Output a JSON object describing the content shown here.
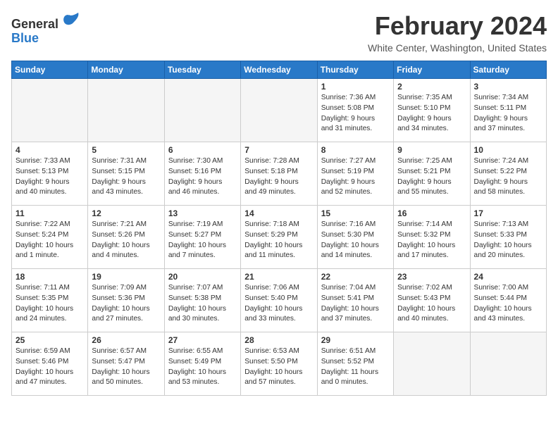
{
  "header": {
    "logo_line1": "General",
    "logo_line2": "Blue",
    "month_title": "February 2024",
    "location": "White Center, Washington, United States"
  },
  "weekdays": [
    "Sunday",
    "Monday",
    "Tuesday",
    "Wednesday",
    "Thursday",
    "Friday",
    "Saturday"
  ],
  "weeks": [
    [
      {
        "day": "",
        "info": ""
      },
      {
        "day": "",
        "info": ""
      },
      {
        "day": "",
        "info": ""
      },
      {
        "day": "",
        "info": ""
      },
      {
        "day": "1",
        "info": "Sunrise: 7:36 AM\nSunset: 5:08 PM\nDaylight: 9 hours\nand 31 minutes."
      },
      {
        "day": "2",
        "info": "Sunrise: 7:35 AM\nSunset: 5:10 PM\nDaylight: 9 hours\nand 34 minutes."
      },
      {
        "day": "3",
        "info": "Sunrise: 7:34 AM\nSunset: 5:11 PM\nDaylight: 9 hours\nand 37 minutes."
      }
    ],
    [
      {
        "day": "4",
        "info": "Sunrise: 7:33 AM\nSunset: 5:13 PM\nDaylight: 9 hours\nand 40 minutes."
      },
      {
        "day": "5",
        "info": "Sunrise: 7:31 AM\nSunset: 5:15 PM\nDaylight: 9 hours\nand 43 minutes."
      },
      {
        "day": "6",
        "info": "Sunrise: 7:30 AM\nSunset: 5:16 PM\nDaylight: 9 hours\nand 46 minutes."
      },
      {
        "day": "7",
        "info": "Sunrise: 7:28 AM\nSunset: 5:18 PM\nDaylight: 9 hours\nand 49 minutes."
      },
      {
        "day": "8",
        "info": "Sunrise: 7:27 AM\nSunset: 5:19 PM\nDaylight: 9 hours\nand 52 minutes."
      },
      {
        "day": "9",
        "info": "Sunrise: 7:25 AM\nSunset: 5:21 PM\nDaylight: 9 hours\nand 55 minutes."
      },
      {
        "day": "10",
        "info": "Sunrise: 7:24 AM\nSunset: 5:22 PM\nDaylight: 9 hours\nand 58 minutes."
      }
    ],
    [
      {
        "day": "11",
        "info": "Sunrise: 7:22 AM\nSunset: 5:24 PM\nDaylight: 10 hours\nand 1 minute."
      },
      {
        "day": "12",
        "info": "Sunrise: 7:21 AM\nSunset: 5:26 PM\nDaylight: 10 hours\nand 4 minutes."
      },
      {
        "day": "13",
        "info": "Sunrise: 7:19 AM\nSunset: 5:27 PM\nDaylight: 10 hours\nand 7 minutes."
      },
      {
        "day": "14",
        "info": "Sunrise: 7:18 AM\nSunset: 5:29 PM\nDaylight: 10 hours\nand 11 minutes."
      },
      {
        "day": "15",
        "info": "Sunrise: 7:16 AM\nSunset: 5:30 PM\nDaylight: 10 hours\nand 14 minutes."
      },
      {
        "day": "16",
        "info": "Sunrise: 7:14 AM\nSunset: 5:32 PM\nDaylight: 10 hours\nand 17 minutes."
      },
      {
        "day": "17",
        "info": "Sunrise: 7:13 AM\nSunset: 5:33 PM\nDaylight: 10 hours\nand 20 minutes."
      }
    ],
    [
      {
        "day": "18",
        "info": "Sunrise: 7:11 AM\nSunset: 5:35 PM\nDaylight: 10 hours\nand 24 minutes."
      },
      {
        "day": "19",
        "info": "Sunrise: 7:09 AM\nSunset: 5:36 PM\nDaylight: 10 hours\nand 27 minutes."
      },
      {
        "day": "20",
        "info": "Sunrise: 7:07 AM\nSunset: 5:38 PM\nDaylight: 10 hours\nand 30 minutes."
      },
      {
        "day": "21",
        "info": "Sunrise: 7:06 AM\nSunset: 5:40 PM\nDaylight: 10 hours\nand 33 minutes."
      },
      {
        "day": "22",
        "info": "Sunrise: 7:04 AM\nSunset: 5:41 PM\nDaylight: 10 hours\nand 37 minutes."
      },
      {
        "day": "23",
        "info": "Sunrise: 7:02 AM\nSunset: 5:43 PM\nDaylight: 10 hours\nand 40 minutes."
      },
      {
        "day": "24",
        "info": "Sunrise: 7:00 AM\nSunset: 5:44 PM\nDaylight: 10 hours\nand 43 minutes."
      }
    ],
    [
      {
        "day": "25",
        "info": "Sunrise: 6:59 AM\nSunset: 5:46 PM\nDaylight: 10 hours\nand 47 minutes."
      },
      {
        "day": "26",
        "info": "Sunrise: 6:57 AM\nSunset: 5:47 PM\nDaylight: 10 hours\nand 50 minutes."
      },
      {
        "day": "27",
        "info": "Sunrise: 6:55 AM\nSunset: 5:49 PM\nDaylight: 10 hours\nand 53 minutes."
      },
      {
        "day": "28",
        "info": "Sunrise: 6:53 AM\nSunset: 5:50 PM\nDaylight: 10 hours\nand 57 minutes."
      },
      {
        "day": "29",
        "info": "Sunrise: 6:51 AM\nSunset: 5:52 PM\nDaylight: 11 hours\nand 0 minutes."
      },
      {
        "day": "",
        "info": ""
      },
      {
        "day": "",
        "info": ""
      }
    ]
  ]
}
